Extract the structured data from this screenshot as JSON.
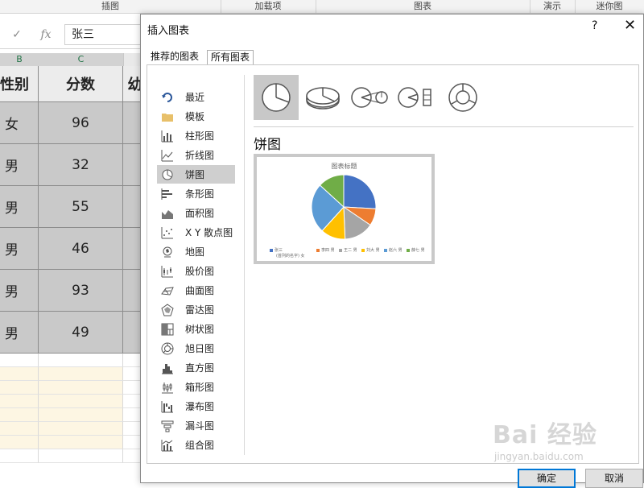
{
  "ribbon": {
    "groups": [
      "插图",
      "加载项",
      "图表",
      "演示",
      "迷你图"
    ]
  },
  "formula_bar": {
    "cancel_icon": "x-icon",
    "enter_icon": "check-icon",
    "fx_label": "fx",
    "value": "张三"
  },
  "sheet": {
    "column_headers": [
      "B",
      "C"
    ],
    "header_row": [
      "性别",
      "分数",
      "幼"
    ],
    "rows": [
      {
        "gender": "女",
        "score": "96"
      },
      {
        "gender": "男",
        "score": "32"
      },
      {
        "gender": "男",
        "score": "55"
      },
      {
        "gender": "男",
        "score": "46"
      },
      {
        "gender": "男",
        "score": "93"
      },
      {
        "gender": "男",
        "score": "49"
      }
    ],
    "cell_fill": "#c9c9c9",
    "tint_fill": "#fdf6e3"
  },
  "dialog": {
    "title": "插入图表",
    "help": "?",
    "close": "✕",
    "tabs": [
      "推荐的图表",
      "所有图表"
    ],
    "chart_types": [
      {
        "label": "最近",
        "icon": "undo-arrow-icon"
      },
      {
        "label": "模板",
        "icon": "folder-icon"
      },
      {
        "label": "柱形图",
        "icon": "column-chart-icon"
      },
      {
        "label": "折线图",
        "icon": "line-chart-icon"
      },
      {
        "label": "饼图",
        "icon": "pie-chart-icon"
      },
      {
        "label": "条形图",
        "icon": "bar-chart-icon"
      },
      {
        "label": "面积图",
        "icon": "area-chart-icon"
      },
      {
        "label": "X Y 散点图",
        "icon": "scatter-chart-icon"
      },
      {
        "label": "地图",
        "icon": "map-chart-icon"
      },
      {
        "label": "股价图",
        "icon": "stock-chart-icon"
      },
      {
        "label": "曲面图",
        "icon": "surface-chart-icon"
      },
      {
        "label": "雷达图",
        "icon": "radar-chart-icon"
      },
      {
        "label": "树状图",
        "icon": "treemap-chart-icon"
      },
      {
        "label": "旭日图",
        "icon": "sunburst-chart-icon"
      },
      {
        "label": "直方图",
        "icon": "histogram-chart-icon"
      },
      {
        "label": "箱形图",
        "icon": "box-whisker-chart-icon"
      },
      {
        "label": "瀑布图",
        "icon": "waterfall-chart-icon"
      },
      {
        "label": "漏斗图",
        "icon": "funnel-chart-icon"
      },
      {
        "label": "组合图",
        "icon": "combo-chart-icon"
      }
    ],
    "selected_type": "饼图",
    "subtypes": [
      "pie-icon",
      "3d-pie-icon",
      "pie-of-pie-icon",
      "bar-of-pie-icon",
      "doughnut-icon"
    ],
    "section_title": "饼图",
    "ok_label": "确定",
    "cancel_label": "取消",
    "accent": "#0078d7"
  },
  "preview_chart": {
    "chart_data": {
      "type": "pie",
      "title": "图表标题",
      "categories": [
        "张三 (首列的名字) 女",
        "李四 男",
        "王二 男",
        "刘大 男",
        "赵六 男",
        "薛七 男"
      ],
      "values": [
        96,
        32,
        55,
        46,
        93,
        49
      ],
      "colors": [
        "#4472c4",
        "#ed7d31",
        "#a5a5a5",
        "#ffc000",
        "#5b9bd5",
        "#70ad47"
      ]
    },
    "legend": [
      "张三",
      "李四 男",
      "王二 男",
      "刘大 男",
      "赵六 男",
      "薛七 男"
    ],
    "legend_second_line": "(首列的名字)  女"
  },
  "watermark": {
    "text": "Bai 经验",
    "sub": "jingyan.baidu.com"
  }
}
